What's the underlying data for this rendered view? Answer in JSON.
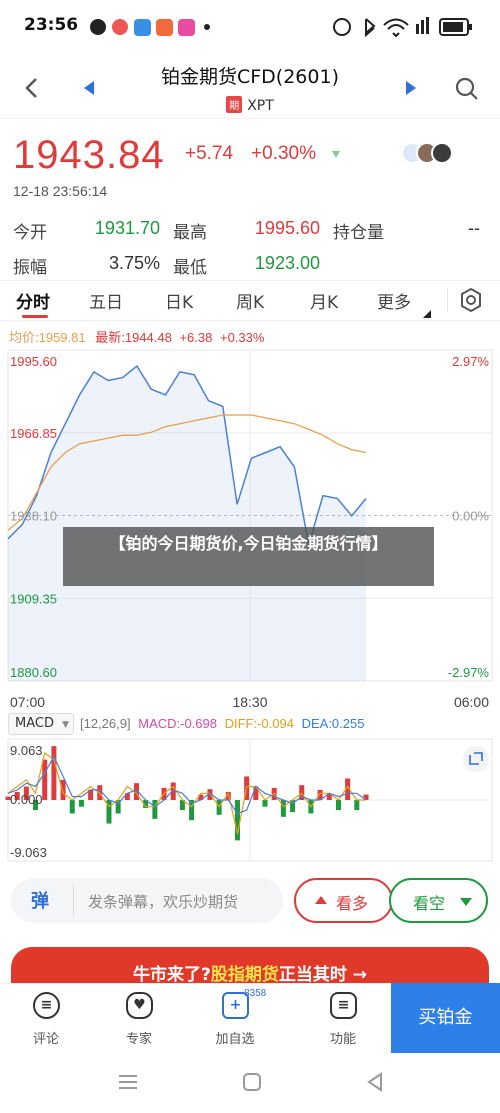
{
  "status_bar": {
    "time": "23:56",
    "battery": ""
  },
  "header": {
    "title": "铂金期货CFD(2601)",
    "badge": "期",
    "symbol": "XPT"
  },
  "quote": {
    "price": "1943.84",
    "change": "+5.74",
    "change_pct": "+0.30%",
    "timestamp": "12-18 23:56:14",
    "open_label": "今开",
    "open_value": "1931.70",
    "high_label": "最高",
    "high_value": "1995.60",
    "oi_label": "持仓量",
    "oi_value": "--",
    "amp_label": "振幅",
    "amp_value": "3.75%",
    "low_label": "最低",
    "low_value": "1923.00"
  },
  "tabs": [
    "分时",
    "五日",
    "日K",
    "周K",
    "月K",
    "更多"
  ],
  "chart_legend": {
    "avg": "均价:1959.81",
    "latest": "最新:1944.48",
    "chg": "+6.38",
    "pct": "+0.33%"
  },
  "chart_data": [
    {
      "type": "line",
      "series": [
        {
          "name": "均价",
          "color": "#e8a04c",
          "values": [
            1933,
            1937,
            1946,
            1955,
            1960,
            1963,
            1964,
            1965,
            1966,
            1966,
            1967,
            1969,
            1970,
            1971,
            1972,
            1973,
            1973,
            1973,
            1972,
            1971,
            1970,
            1968,
            1966,
            1963,
            1961,
            1960
          ]
        },
        {
          "name": "最新",
          "color": "#4a80d6",
          "values": [
            1930,
            1935,
            1945,
            1960,
            1970,
            1980,
            1988,
            1985,
            1986,
            1990,
            1982,
            1980,
            1988,
            1987,
            1978,
            1976,
            1942,
            1958,
            1960,
            1962,
            1955,
            1928,
            1945,
            1944,
            1938,
            1944
          ]
        }
      ],
      "y_labels_left": [
        "1995.60",
        "1966.85",
        "1938.10",
        "1909.35",
        "1880.60"
      ],
      "y_labels_right": [
        "2.97%",
        "",
        "0.00%",
        "",
        "-2.97%"
      ],
      "x_labels": [
        "07:00",
        "18:30",
        "06:00"
      ],
      "ylim": [
        1880.6,
        1995.6
      ]
    },
    {
      "type": "bar",
      "indicator": "MACD",
      "params": "[12,26,9]",
      "macd": "MACD:-0.698",
      "diff": "DIFF:-0.094",
      "dea": "DEA:0.255",
      "y_labels": [
        "9.063",
        "0.000",
        "-9.063"
      ],
      "ylim": [
        -9.063,
        9.063
      ]
    }
  ],
  "actions": {
    "danmu_icon": "弹",
    "danmu_placeholder": "发条弹幕，欢乐炒期货",
    "bull_label": "看多",
    "bear_label": "看空"
  },
  "banner": {
    "text_a": "牛市来了?",
    "text_b": "股指期货",
    "text_c": "正当其时",
    "arrow": "→"
  },
  "bottom_nav": {
    "items": [
      {
        "label": "评论",
        "icon": "comment-icon",
        "glyph": "≡"
      },
      {
        "label": "专家",
        "icon": "expert-icon",
        "glyph": "♥"
      },
      {
        "label": "加自选",
        "icon": "add-watch-icon",
        "glyph": "+",
        "badge": "8358"
      },
      {
        "label": "功能",
        "icon": "function-icon",
        "glyph": "≡"
      }
    ],
    "buy_label": "买铂金"
  },
  "overlay": {
    "text": "【铂的今日期货价,今日铂金期货行情】"
  },
  "colors": {
    "up": "#e03a3a",
    "down": "#1e9a3e",
    "buy": "#2f7fe8"
  }
}
